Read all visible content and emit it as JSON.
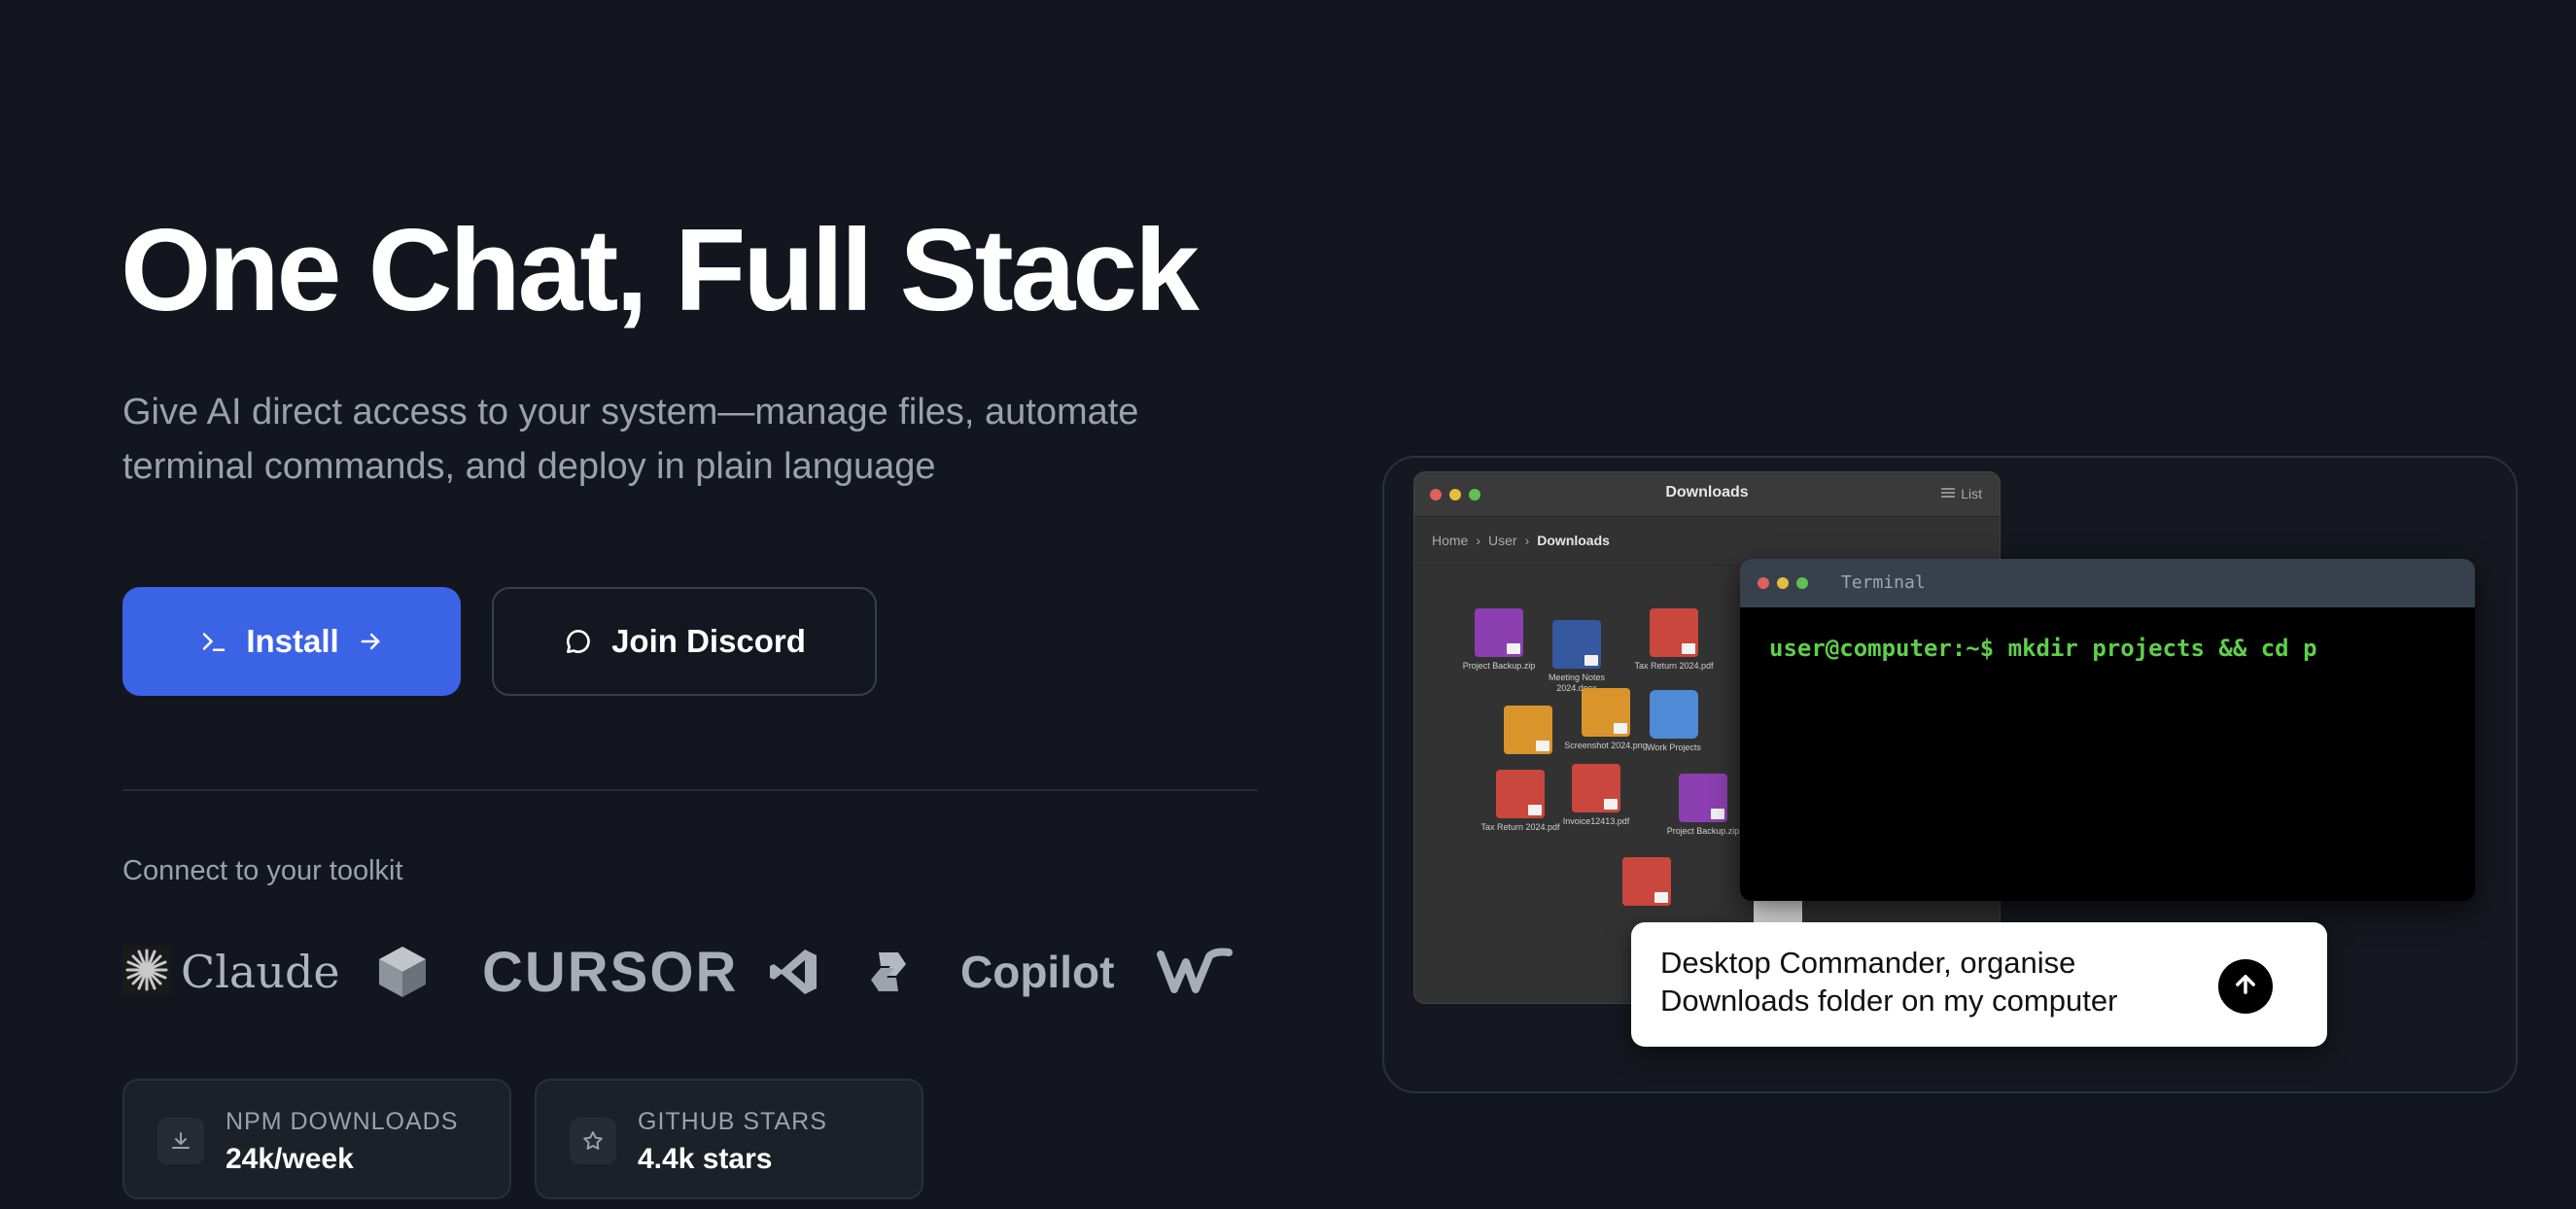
{
  "hero": {
    "title": "One Chat, Full Stack",
    "subtitle": "Give AI direct access to your system—manage files, automate terminal commands, and deploy in plain language"
  },
  "buttons": {
    "install_label": "Install",
    "discord_label": "Join Discord"
  },
  "toolkit": {
    "label": "Connect to your toolkit",
    "logos": [
      {
        "name": "Claude",
        "icon": "claude-sparkle-icon"
      },
      {
        "name": "",
        "icon": "cube-icon"
      },
      {
        "name": "CURSOR",
        "icon": "cursor-wordmark"
      },
      {
        "name": "",
        "icon": "vscode-icon"
      },
      {
        "name": "Copilot",
        "icon": "copilot-icon"
      },
      {
        "name": "",
        "icon": "windsurf-icon"
      }
    ]
  },
  "stats": [
    {
      "label": "NPM DOWNLOADS",
      "value": "24k/week",
      "icon": "download-icon"
    },
    {
      "label": "GITHUB STARS",
      "value": "4.4k stars",
      "icon": "star-icon"
    }
  ],
  "demo": {
    "finder": {
      "title": "Downloads",
      "view_label": "List",
      "breadcrumb": [
        "Home",
        "User",
        "Downloads"
      ],
      "files": [
        {
          "name": "Project Backup.zip",
          "color": "#8c3fb0"
        },
        {
          "name": "Meeting Notes 2024.docx",
          "color": "#35589e"
        },
        {
          "name": "Tax Return 2024.pdf",
          "color": "#c9473d"
        },
        {
          "name": "Screenshot 2024.png",
          "color": "#d9952b"
        },
        {
          "name": "Work Projects",
          "color": "#4f8ad6"
        },
        {
          "name": "",
          "color": "#d9952b"
        },
        {
          "name": "Tax Return 2024.pdf",
          "color": "#c9473d"
        },
        {
          "name": "Invoice12413.pdf",
          "color": "#c9473d"
        },
        {
          "name": "Project Backup.zip",
          "color": "#8c3fb0"
        },
        {
          "name": "",
          "color": "#c9473d"
        }
      ]
    },
    "terminal": {
      "title": "Terminal",
      "command": "user@computer:~$ mkdir projects && cd p"
    },
    "prompt": {
      "text": "Desktop Commander, organise Downloads folder on my computer"
    }
  },
  "colors": {
    "background": "#13161e",
    "accent": "#3b63e6",
    "terminal_green": "#5fcf4a"
  }
}
